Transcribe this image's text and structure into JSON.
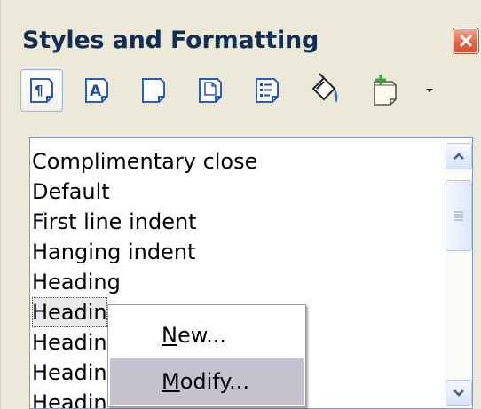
{
  "window": {
    "title": "Styles and Formatting",
    "close_icon": "close-icon"
  },
  "toolbar": {
    "buttons": [
      {
        "name": "paragraph-styles",
        "icon": "paragraph-icon",
        "active": true
      },
      {
        "name": "character-styles",
        "icon": "character-style-icon"
      },
      {
        "name": "frame-styles",
        "icon": "frame-icon"
      },
      {
        "name": "page-styles",
        "icon": "page-icon"
      },
      {
        "name": "list-styles",
        "icon": "list-icon"
      },
      {
        "name": "fill-format-mode",
        "icon": "paint-bucket-icon"
      },
      {
        "name": "new-style-from-selection",
        "icon": "new-style-icon"
      },
      {
        "name": "more",
        "icon": "dropdown-arrow-icon"
      }
    ]
  },
  "styles_list": {
    "items": [
      "Complimentary close",
      "Default",
      "First line indent",
      "Hanging indent",
      "Heading",
      "Headin",
      "Headin",
      "Headin",
      "Headin"
    ],
    "selected_index": 5
  },
  "context_menu": {
    "items": [
      {
        "mnemonic": "N",
        "rest": "ew..."
      },
      {
        "mnemonic": "M",
        "rest": "odify..."
      }
    ],
    "hover_index": 1
  },
  "colors": {
    "title_text": "#0f2f57",
    "panel_bg": "#ece9d8",
    "menu_hover": "#c4c2cf",
    "close_button": "#e26a4a",
    "toolbar_icon_blue": "#1f57b5"
  }
}
